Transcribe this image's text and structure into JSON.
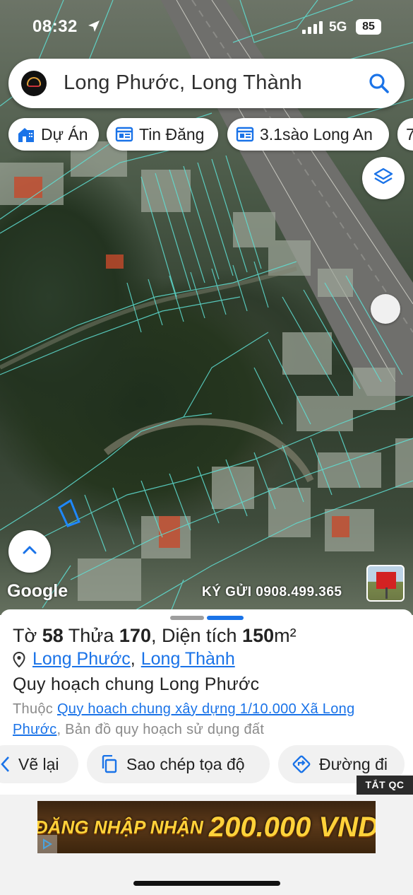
{
  "status_bar": {
    "time": "08:32",
    "network": "5G",
    "battery": "85",
    "location_icon": "location-arrow-icon",
    "signal_icon": "signal-bars-icon"
  },
  "search": {
    "query": "Long Phước, Long Thành",
    "logo": "app-logo",
    "icon": "search-icon"
  },
  "chips": [
    {
      "label": "Dự Án",
      "icon": "project-building-icon"
    },
    {
      "label": "Tin Đăng",
      "icon": "listing-card-icon"
    },
    {
      "label": "3.1sào Long An",
      "icon": "listing-card-icon"
    },
    {
      "label": "7",
      "icon": ""
    }
  ],
  "map": {
    "layers_icon": "layers-icon",
    "expand_icon": "chevron-up-icon",
    "google_label": "Google",
    "consign_text": "KÝ GỬI 0908.499.365",
    "colors": {
      "parcel_line": "#5fe0d4",
      "selected_parcel": "#1e88ff"
    }
  },
  "sheet": {
    "parcel": {
      "sheet_prefix": "Tờ",
      "sheet_no": "58",
      "lot_prefix": "Thửa",
      "lot_no": "170",
      "area_prefix": ", Diện tích",
      "area_value": "150",
      "area_unit": "m²"
    },
    "location": {
      "ward": "Long Phước",
      "district": "Long Thành",
      "separator": ","
    },
    "plan_title": "Quy hoạch chung Long Phước",
    "plan_desc": {
      "prefix": "Thuộc",
      "link": "Quy hoach chung xây dựng 1/10.000 Xã Long Phước",
      "suffix": ", Bản đồ quy hoạch sử dụng đất"
    },
    "actions": [
      {
        "label": "Vẽ lại",
        "icon": "redraw-icon"
      },
      {
        "label": "Sao chép tọa độ",
        "icon": "copy-icon"
      },
      {
        "label": "Đường đi",
        "icon": "directions-icon"
      }
    ]
  },
  "ads": {
    "hide_label": "TẮT QC",
    "banner_line1": "ĐĂNG NHẬP NHẬN",
    "banner_line2": "200.000 VND",
    "adchoice_icon": "adchoices-icon"
  }
}
